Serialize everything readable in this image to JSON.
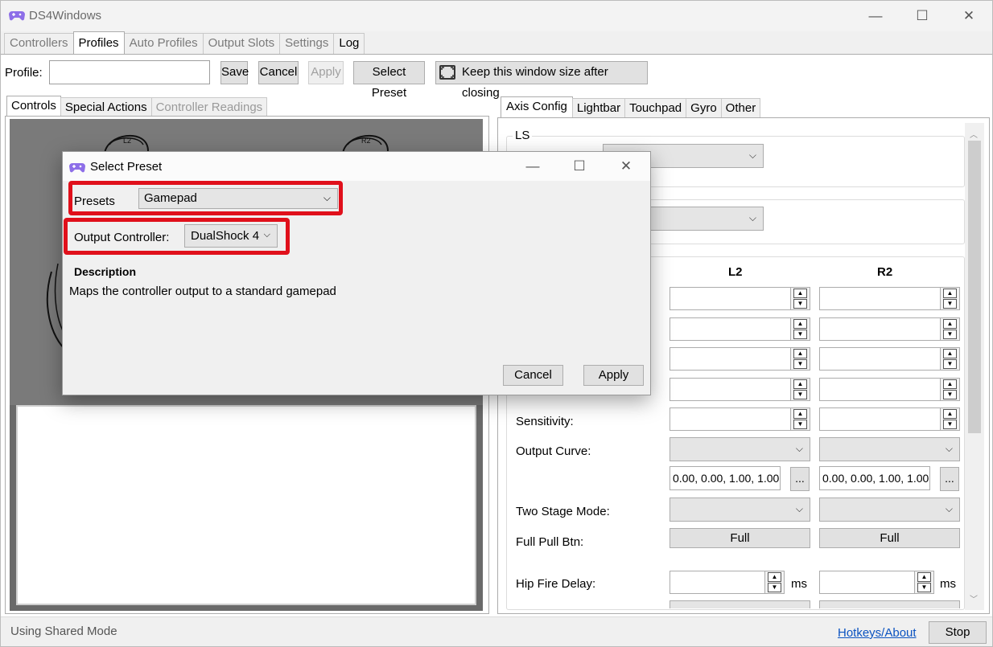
{
  "app": {
    "title": "DS4Windows"
  },
  "window_controls": {
    "minimize": "—",
    "maximize": "☐",
    "close": "✕"
  },
  "main_tabs": [
    "Controllers",
    "Profiles",
    "Auto Profiles",
    "Output Slots",
    "Settings",
    "Log"
  ],
  "profile_bar": {
    "label": "Profile:",
    "value": "",
    "save": "Save",
    "cancel": "Cancel",
    "apply": "Apply",
    "select_preset": "Select Preset",
    "keep_size": "Keep this window size after closing"
  },
  "left_tabs": [
    "Controls",
    "Special Actions",
    "Controller Readings"
  ],
  "controller_labels": {
    "l2": "L2",
    "r2": "R2"
  },
  "right_tabs": [
    "Axis Config",
    "Lightbar",
    "Touchpad",
    "Gyro",
    "Other"
  ],
  "axis_config": {
    "ls_group_label": "LS",
    "col_l2": "L2",
    "col_r2": "R2",
    "sensitivity_label": "Sensitivity:",
    "output_curve_label": "Output Curve:",
    "curve_l2": "0.00, 0.00, 1.00, 1.00",
    "curve_r2": "0.00, 0.00, 1.00, 1.00",
    "ellipsis": "...",
    "two_stage_label": "Two Stage Mode:",
    "full_pull_label": "Full Pull Btn:",
    "full_l2": "Full",
    "full_r2": "Full",
    "hip_fire_label": "Hip Fire Delay:",
    "ms": "ms"
  },
  "status": {
    "mode": "Using Shared Mode",
    "hotkeys": "Hotkeys/About",
    "stop": "Stop"
  },
  "dialog": {
    "title": "Select Preset",
    "presets_label": "Presets",
    "presets_value": "Gamepad",
    "output_label": "Output Controller:",
    "output_value": "DualShock 4",
    "description_header": "Description",
    "description_text": "Maps the controller output to a standard gamepad",
    "cancel": "Cancel",
    "apply": "Apply"
  },
  "colors": {
    "highlight": "#e0101b",
    "link": "#0b53c1"
  }
}
